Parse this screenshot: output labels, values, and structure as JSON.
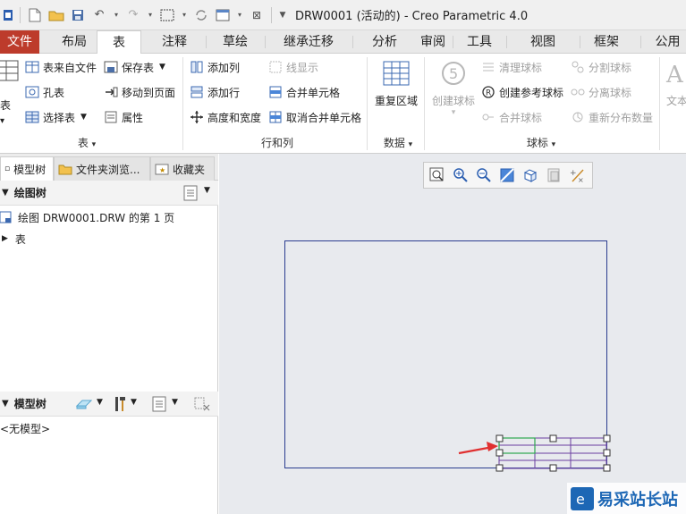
{
  "window": {
    "title": "DRW0001 (活动的) - Creo Parametric 4.0"
  },
  "ribbon_tabs": [
    {
      "label": "文件"
    },
    {
      "label": "布局"
    },
    {
      "label": "表"
    },
    {
      "label": "注释"
    },
    {
      "label": "草绘"
    },
    {
      "label": "继承迁移"
    },
    {
      "label": "分析"
    },
    {
      "label": "审阅"
    },
    {
      "label": "工具"
    },
    {
      "label": "视图"
    },
    {
      "label": "框架"
    },
    {
      "label": "公用"
    }
  ],
  "ribbon": {
    "table_group": {
      "label": "表",
      "partial_label": "表",
      "from_file": "表来自文件",
      "save_table": "保存表",
      "hole_table": "孔表",
      "move_to_page": "移动到页面",
      "select_table": "选择表",
      "properties": "属性"
    },
    "rows_cols_group": {
      "label": "行和列",
      "add_column": "添加列",
      "line_display": "线显示",
      "add_row": "添加行",
      "merge_cells": "合并单元格",
      "height_width": "高度和宽度",
      "unmerge_cells": "取消合并单元格"
    },
    "data_group": {
      "label": "数据",
      "repeat_region": "重复区域"
    },
    "balloon_group": {
      "label": "球标",
      "create_balloon": "创建球标",
      "clean_balloon": "清理球标",
      "create_ref_balloon": "创建参考球标",
      "merge_balloon": "合并球标",
      "split_balloon": "分割球标",
      "detach_balloon": "分离球标",
      "redistribute_qty": "重新分布数量"
    },
    "text_group": {
      "partial_label": "文本"
    }
  },
  "left_panel": {
    "tabs": [
      {
        "label": "模型树"
      },
      {
        "label": "文件夹浏览..."
      },
      {
        "label": "收藏夹"
      }
    ],
    "drawing_tree": {
      "title": "绘图树",
      "items": [
        {
          "label": "绘图 DRW0001.DRW 的第 1 页"
        },
        {
          "label": "表"
        }
      ]
    },
    "model_tree": {
      "title": "模型树",
      "empty_text": "<无模型>"
    }
  },
  "colors": {
    "file_tab": "#bd3b2b",
    "sheet_border": "#2b3d8f",
    "table_purple": "#6a3fa0",
    "table_green": "#2fa84f",
    "arrow_red": "#e03030"
  },
  "watermark": {
    "text": "易采站长站"
  }
}
